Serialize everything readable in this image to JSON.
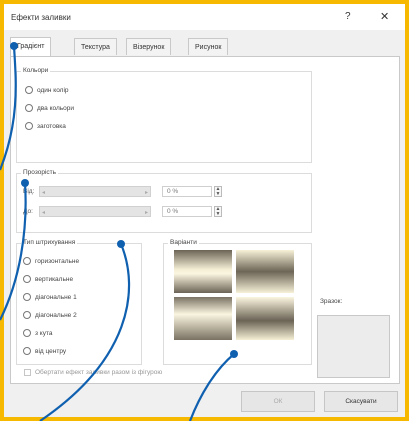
{
  "window": {
    "title": "Ефекти заливки",
    "help_glyph": "?",
    "close_glyph": "✕"
  },
  "tabs": [
    {
      "label": "Градієнт",
      "active": true
    },
    {
      "label": "Текстура",
      "active": false
    },
    {
      "label": "Візерунок",
      "active": false
    },
    {
      "label": "Рисунок",
      "active": false
    }
  ],
  "colors_group": {
    "legend": "Кольори",
    "options": [
      "один колір",
      "два кольори",
      "заготовка"
    ]
  },
  "transparency_group": {
    "legend": "Прозорість",
    "from_label": "Від:",
    "to_label": "До:",
    "from_value": "0 %",
    "to_value": "0 %",
    "arrow_left": "◂",
    "arrow_right": "▸",
    "spin_up": "▲",
    "spin_down": "▼"
  },
  "shading_group": {
    "legend": "Тип штрихування",
    "options": [
      "горизонтальне",
      "вертикальне",
      "діагональне 1",
      "діагональне 2",
      "з кута",
      "від центру"
    ]
  },
  "variants_group": {
    "legend": "Варіанти"
  },
  "sample": {
    "label": "Зразок:"
  },
  "rotate_checkbox": {
    "label": "Обертати ефект заливки разом із фігурою"
  },
  "buttons": {
    "ok": "ОК",
    "cancel": "Скасувати"
  },
  "colors": {
    "accent_frame": "#f6b900",
    "callout_line": "#1060b0"
  }
}
